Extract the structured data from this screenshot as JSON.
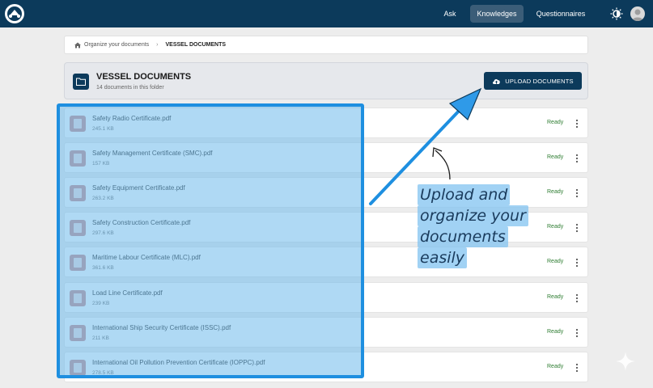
{
  "nav": {
    "ask": "Ask",
    "knowledges": "Knowledges",
    "questionnaires": "Questionnaires"
  },
  "breadcrumb": {
    "home": "Organize your documents",
    "current": "VESSEL DOCUMENTS"
  },
  "folder": {
    "title": "VESSEL DOCUMENTS",
    "subtitle": "14 documents in this folder",
    "upload_label": "UPLOAD DOCUMENTS"
  },
  "files": [
    {
      "name": "Safety Radio Certificate.pdf",
      "size": "245.1 KB",
      "status": "Ready"
    },
    {
      "name": "Safety Management Certificate (SMC).pdf",
      "size": "157 KB",
      "status": "Ready"
    },
    {
      "name": "Safety Equipment Certificate.pdf",
      "size": "263.2 KB",
      "status": "Ready"
    },
    {
      "name": "Safety Construction Certificate.pdf",
      "size": "297.6 KB",
      "status": "Ready"
    },
    {
      "name": "Maritime Labour Certificate (MLC).pdf",
      "size": "361.6 KB",
      "status": "Ready"
    },
    {
      "name": "Load Line Certificate.pdf",
      "size": "239 KB",
      "status": "Ready"
    },
    {
      "name": "International Ship Security Certificate (ISSC).pdf",
      "size": "211 KB",
      "status": "Ready"
    },
    {
      "name": "International Oil Pollution Prevention Certificate (IOPPC).pdf",
      "size": "278.5 KB",
      "status": "Ready"
    }
  ],
  "annotation": {
    "line1": "Upload and",
    "line2": "organize your",
    "line3": "documents",
    "line4": "easily"
  },
  "colors": {
    "topbar": "#0c3a5b",
    "accent": "#1e8fe0",
    "status_ready": "#2e7d32"
  }
}
